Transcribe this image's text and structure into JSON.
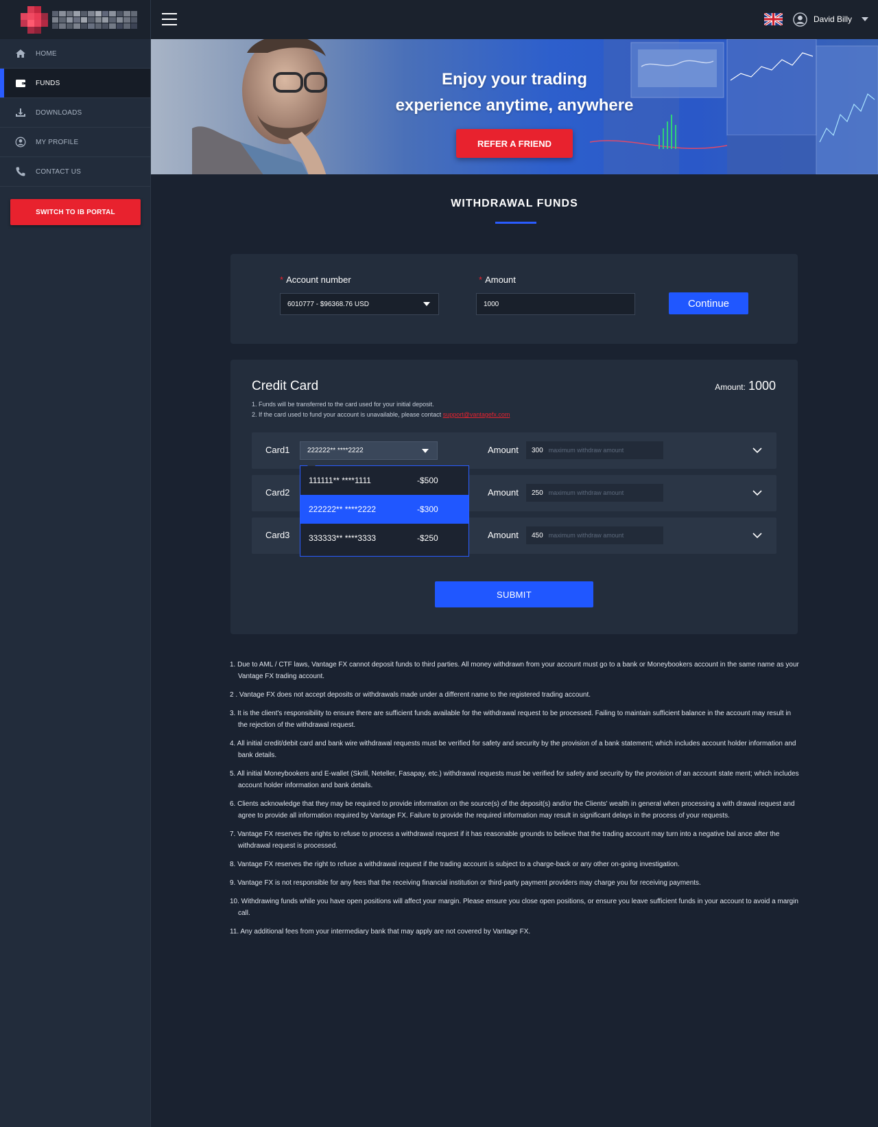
{
  "user": {
    "name": "David Billy"
  },
  "sidebar": {
    "items": [
      {
        "label": "HOME",
        "icon": "home-icon"
      },
      {
        "label": "FUNDS",
        "icon": "wallet-icon",
        "active": true
      },
      {
        "label": "DOWNLOADS",
        "icon": "download-icon"
      },
      {
        "label": "MY PROFILE",
        "icon": "user-circle-icon"
      },
      {
        "label": "CONTACT US",
        "icon": "phone-icon"
      }
    ],
    "switch_label": "SWITCH TO IB PORTAL"
  },
  "banner": {
    "line1": "Enjoy your trading",
    "line2": "experience anytime, anywhere",
    "refer_label": "REFER A FRIEND"
  },
  "page": {
    "title": "WITHDRAWAL FUNDS"
  },
  "form": {
    "account_label": "Account number",
    "account_value": "6010777 - $96368.76 USD",
    "amount_label": "Amount",
    "amount_value": "1000",
    "continue_label": "Continue"
  },
  "credit_card": {
    "title": "Credit Card",
    "amount_label": "Amount:",
    "amount_value": "1000",
    "note1": "1. Funds will be transferred to the card used for your initial deposit.",
    "note2": "2. If the card used to fund your account is unavailable, please contact ",
    "support_email": "support@vantagefx.com",
    "amount_row_label": "Amount",
    "placeholder": "maximum withdraw amount",
    "rows": [
      {
        "label": "Card1",
        "selected_card": "222222** ****2222",
        "amount": "300"
      },
      {
        "label": "Card2",
        "amount": "250"
      },
      {
        "label": "Card3",
        "amount": "450"
      }
    ],
    "dropdown": [
      {
        "card": "111111** ****1111",
        "balance": "-$500"
      },
      {
        "card": "222222** ****2222",
        "balance": "-$300",
        "selected": true
      },
      {
        "card": "333333** ****3333",
        "balance": "-$250"
      }
    ],
    "submit_label": "SUBMIT"
  },
  "terms": [
    "1. Due to AML / CTF laws, Vantage FX cannot deposit funds to third parties. All money withdrawn from your account must go to a bank or Moneybookers account in the same name as your Vantage FX trading account.",
    "2 . Vantage FX does not accept deposits or withdrawals made under a different name to the registered trading account.",
    "3. It is the client's responsibility to ensure there are sufficient funds available for the withdrawal request to be processed. Failing to maintain sufficient balance in the account may result in the rejection of the withdrawal request.",
    "4. All initial credit/debit card and bank wire withdrawal requests must be verified for safety and security by the provision of a bank statement; which includes account holder information and bank details.",
    "5. All initial Moneybookers and E-wallet (Skrill, Neteller, Fasapay, etc.) withdrawal requests must be verified for safety and security by the provision of an account state ment; which includes account holder information and bank details.",
    "6. Clients acknowledge that they may be required to provide information on the source(s) of the deposit(s) and/or the Clients' wealth in general when processing a with drawal request and agree to provide all information required by Vantage FX. Failure to provide the required information may result in significant delays in the process of your requests.",
    "7. Vantage FX reserves the rights to refuse to process a withdrawal request if it has reasonable grounds to believe that the trading account may turn into a negative bal ance after the withdrawal request is processed.",
    "8. Vantage FX reserves the right to refuse a withdrawal request if the trading account is subject to a charge-back or any other on-going investigation.",
    "9. Vantage FX is not responsible for any fees that the receiving financial institution or third-party payment providers may charge you for receiving payments.",
    "10. Withdrawing funds while you have open positions will affect your margin. Please ensure you close open positions, or ensure you leave sufficient funds in your account to avoid a margin call.",
    "11. Any additional fees from your intermediary bank that may apply are not covered by Vantage FX."
  ],
  "colors": {
    "accent": "#2057ff",
    "brand_red": "#e8222e",
    "background": "#1a2230",
    "panel": "#232d3c"
  }
}
